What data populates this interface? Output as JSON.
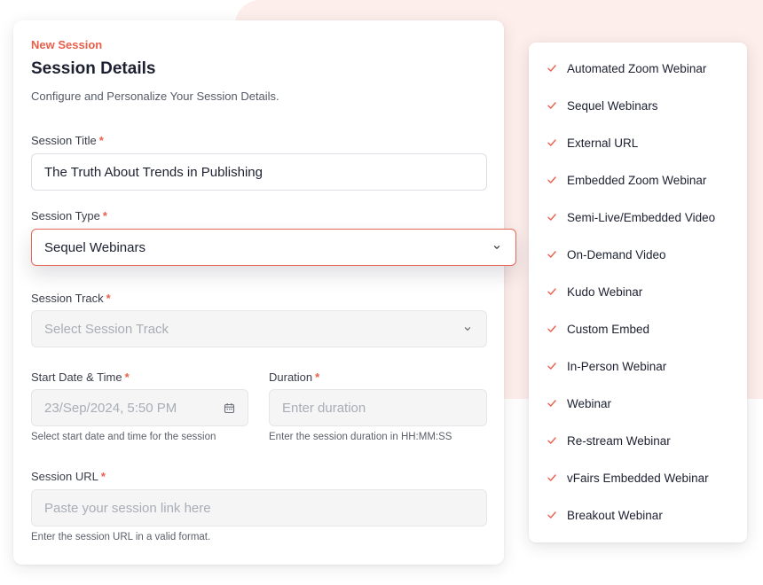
{
  "form": {
    "eyebrow": "New Session",
    "title": "Session Details",
    "subtitle": "Configure and Personalize Your Session Details.",
    "required_mark": "*",
    "session_title": {
      "label": "Session Title",
      "value": "The Truth About Trends in Publishing"
    },
    "session_type": {
      "label": "Session Type",
      "value": "Sequel Webinars"
    },
    "session_track": {
      "label": "Session Track",
      "placeholder": "Select Session Track"
    },
    "start_datetime": {
      "label": "Start Date & Time",
      "value": "23/Sep/2024, 5:50 PM",
      "hint": "Select start date and time for the session"
    },
    "duration": {
      "label": "Duration",
      "placeholder": "Enter duration",
      "hint": "Enter the session duration in HH:MM:SS"
    },
    "session_url": {
      "label": "Session URL",
      "placeholder": "Paste your session link here",
      "hint": "Enter the session URL in a valid format."
    }
  },
  "session_type_options": [
    "Automated Zoom Webinar",
    "Sequel Webinars",
    "External URL",
    "Embedded Zoom Webinar",
    "Semi-Live/Embedded Video",
    "On-Demand Video",
    "Kudo Webinar",
    "Custom Embed",
    "In-Person Webinar",
    "Webinar",
    "Re-stream Webinar",
    "vFairs Embedded Webinar",
    "Breakout Webinar"
  ],
  "icons": {
    "dropdown": "chevron-down-icon",
    "calendar": "calendar-icon",
    "option_check": "check-icon"
  },
  "colors": {
    "accent": "#e8604c",
    "background_blob": "#fdeeeb"
  }
}
